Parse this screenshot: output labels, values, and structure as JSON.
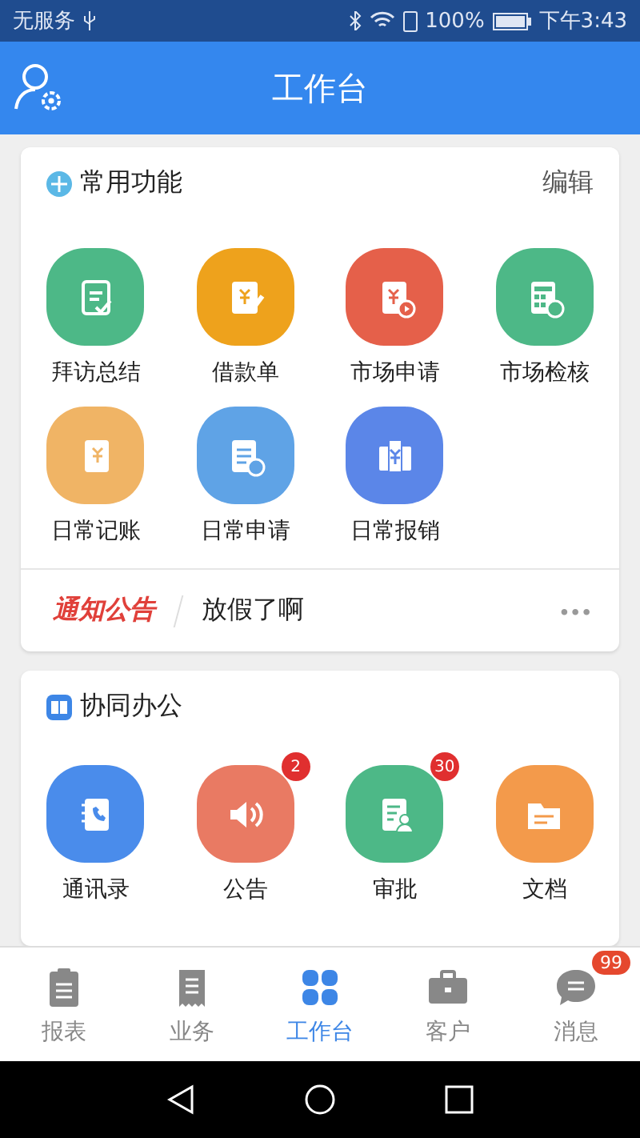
{
  "status_bar": {
    "carrier": "无服务",
    "battery": "100%",
    "time": "下午3:43"
  },
  "header": {
    "title": "工作台"
  },
  "common": {
    "title": "常用功能",
    "action": "编辑",
    "items": [
      {
        "label": "拜访总结",
        "color": "#4db887"
      },
      {
        "label": "借款单",
        "color": "#eea21c"
      },
      {
        "label": "市场申请",
        "color": "#e5604a"
      },
      {
        "label": "市场检核",
        "color": "#4db887"
      },
      {
        "label": "日常记账",
        "color": "#f0b465"
      },
      {
        "label": "日常申请",
        "color": "#5fa3e6"
      },
      {
        "label": "日常报销",
        "color": "#5b86e8"
      }
    ]
  },
  "notice": {
    "tag": "通知公告",
    "text": "放假了啊",
    "more": "•••"
  },
  "collab": {
    "title": "协同办公",
    "items": [
      {
        "label": "通讯录",
        "color": "#4a8ceb"
      },
      {
        "label": "公告",
        "color": "#e97a63",
        "badge": "2"
      },
      {
        "label": "审批",
        "color": "#4db887",
        "badge": "30"
      },
      {
        "label": "文档",
        "color": "#f39a4b"
      }
    ]
  },
  "tabbar": [
    {
      "label": "报表",
      "selected": false
    },
    {
      "label": "业务",
      "selected": false
    },
    {
      "label": "工作台",
      "selected": true
    },
    {
      "label": "客户",
      "selected": false
    },
    {
      "label": "消息",
      "selected": false,
      "badge": "99"
    }
  ]
}
